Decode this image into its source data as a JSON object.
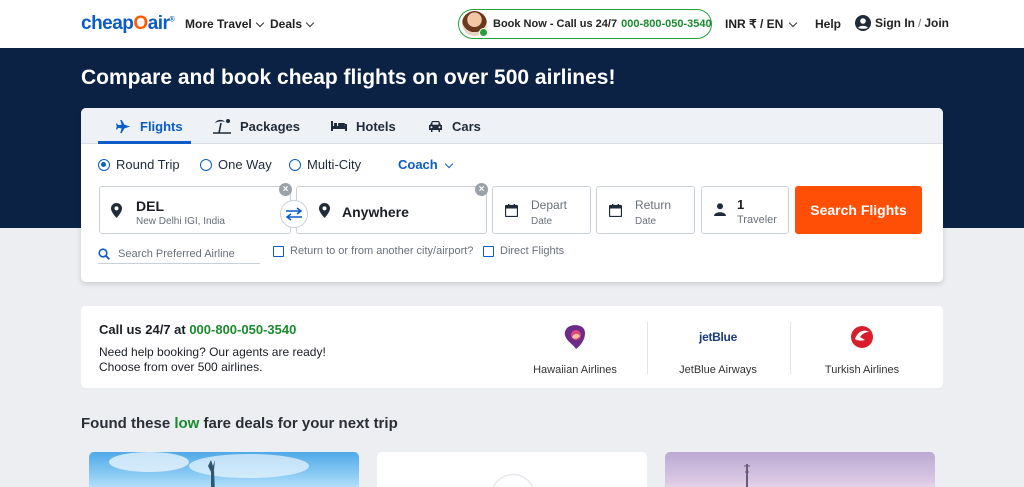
{
  "header": {
    "logo_main": "cheap",
    "logo_o": "O",
    "logo_end": "air",
    "logo_mark": "®",
    "nav": [
      "More Travel",
      "Deals"
    ],
    "book_label": "Book Now - Call us 24/7",
    "book_phone": "000-800-050-3540",
    "locale": "INR ₹ / EN",
    "help": "Help",
    "sign_in": "Sign In",
    "join": "Join"
  },
  "hero": {
    "title": "Compare and book cheap flights on over 500 airlines!"
  },
  "search": {
    "tabs": [
      {
        "label": "Flights",
        "icon": "plane-icon"
      },
      {
        "label": "Packages",
        "icon": "beach-icon"
      },
      {
        "label": "Hotels",
        "icon": "bed-icon"
      },
      {
        "label": "Cars",
        "icon": "car-icon"
      }
    ],
    "trip_types": [
      "Round Trip",
      "One Way",
      "Multi-City"
    ],
    "cabin": "Coach",
    "from": {
      "code": "DEL",
      "name": "New Delhi IGI, India"
    },
    "to": {
      "value": "Anywhere"
    },
    "depart": {
      "label": "Depart",
      "sub": "Date"
    },
    "return": {
      "label": "Return",
      "sub": "Date"
    },
    "travelers": {
      "count": "1",
      "label": "Traveler"
    },
    "button": "Search Flights",
    "airline_placeholder": "Search Preferred Airline",
    "return_other": "Return to or from another city/airport?",
    "direct": "Direct Flights"
  },
  "help_section": {
    "title_prefix": "Call us 24/7 at ",
    "phone": "000-800-050-3540",
    "line1": "Need help booking? Our agents are ready!",
    "line2": "Choose from over 500 airlines.",
    "airlines": [
      "Hawaiian Airlines",
      "JetBlue Airways",
      "Turkish Airlines"
    ],
    "jetblue_logo": "jetBlue"
  },
  "deals": {
    "prefix": "Found these ",
    "low": "low",
    "suffix": " fare deals for your next trip"
  },
  "colors": {
    "brand_blue": "#0b5cc6",
    "hero_navy": "#0c2244",
    "cta_orange": "#ff4f07",
    "phone_green": "#1a8a2d"
  }
}
